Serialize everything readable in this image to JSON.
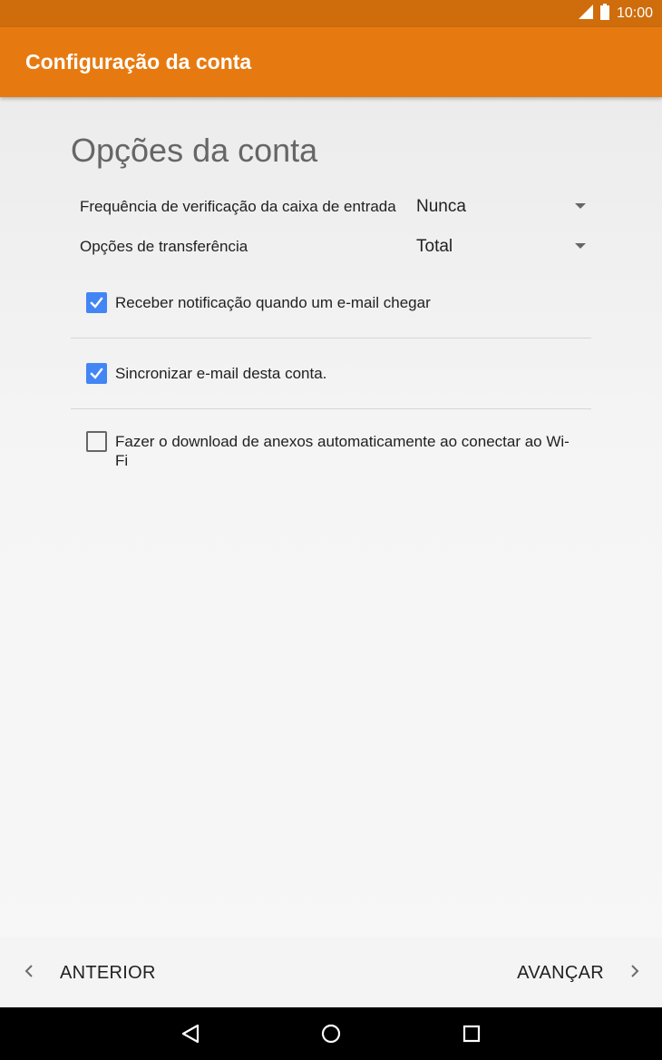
{
  "status_bar": {
    "time": "10:00",
    "icons": [
      "signal-icon",
      "battery-icon"
    ]
  },
  "app_bar": {
    "title": "Configuração da conta",
    "color": "#e67a11"
  },
  "main": {
    "heading": "Opções da conta",
    "settings": [
      {
        "label": "Frequência de verificação da caixa de entrada",
        "value": "Nunca"
      },
      {
        "label": "Opções de transferência",
        "value": "Total"
      }
    ],
    "checkboxes": [
      {
        "label": "Receber notificação quando um e-mail chegar",
        "checked": true
      },
      {
        "label": "Sincronizar e-mail desta conta.",
        "checked": true
      },
      {
        "label": "Fazer o download de anexos automaticamente ao conectar ao Wi-Fi",
        "checked": false
      }
    ]
  },
  "footer": {
    "prev_label": "ANTERIOR",
    "next_label": "AVANÇAR",
    "prev_icon": "chevron-left-icon",
    "next_icon": "chevron-right-icon"
  },
  "system_nav": {
    "icons": [
      "back-icon",
      "home-icon",
      "recents-icon"
    ]
  },
  "colors": {
    "status_bar": "#cf6d0c",
    "accent": "#e67a11",
    "checkbox": "#4285f4"
  }
}
